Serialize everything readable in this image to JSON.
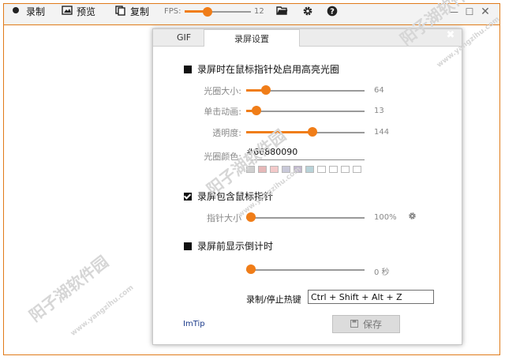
{
  "toolbar": {
    "record_label": "录制",
    "preview_label": "预览",
    "copy_label": "复制",
    "fps_label": "FPS:",
    "fps_value": "12",
    "fps_level": 0.35
  },
  "tabs": [
    {
      "label": "GIF"
    },
    {
      "label": "录屏设置"
    }
  ],
  "highlight_section": {
    "title": "录屏时在鼠标指针处启用高亮光圈",
    "checked": true,
    "size_label": "光圈大小:",
    "size_value": "64",
    "animation_label": "单击动画:",
    "animation_value": "13",
    "opacity_label": "透明度:",
    "opacity_value": "144",
    "color_label": "光圈颜色:",
    "color_value": "#66880090",
    "swatch_colors": [
      "#cfcfcf",
      "#e6b8b8",
      "#f3c9c9",
      "#c9c9d9",
      "#c2b8cf",
      "#b9d3d9",
      "#ffffff",
      "#ffffff",
      "#ffffff",
      "#ffffff"
    ]
  },
  "cursor_section": {
    "title": "录屏包含鼠标指针",
    "checked": true,
    "pointer_size_label": "指针大小",
    "pointer_size_value": "100%"
  },
  "countdown_section": {
    "title": "录屏前显示倒计时",
    "checked": true,
    "value": "0 秒"
  },
  "hotkey": {
    "label": "录制/停止热键",
    "value": "Ctrl + Shift + Alt + Z"
  },
  "footer": {
    "link_label": "ImTip",
    "save_label": "保存"
  },
  "watermark": {
    "text": "阳子湖软件园",
    "url": "www.yangzihu.com"
  },
  "colors": {
    "accent": "#f07d18",
    "window_border": "#e07b1a"
  }
}
